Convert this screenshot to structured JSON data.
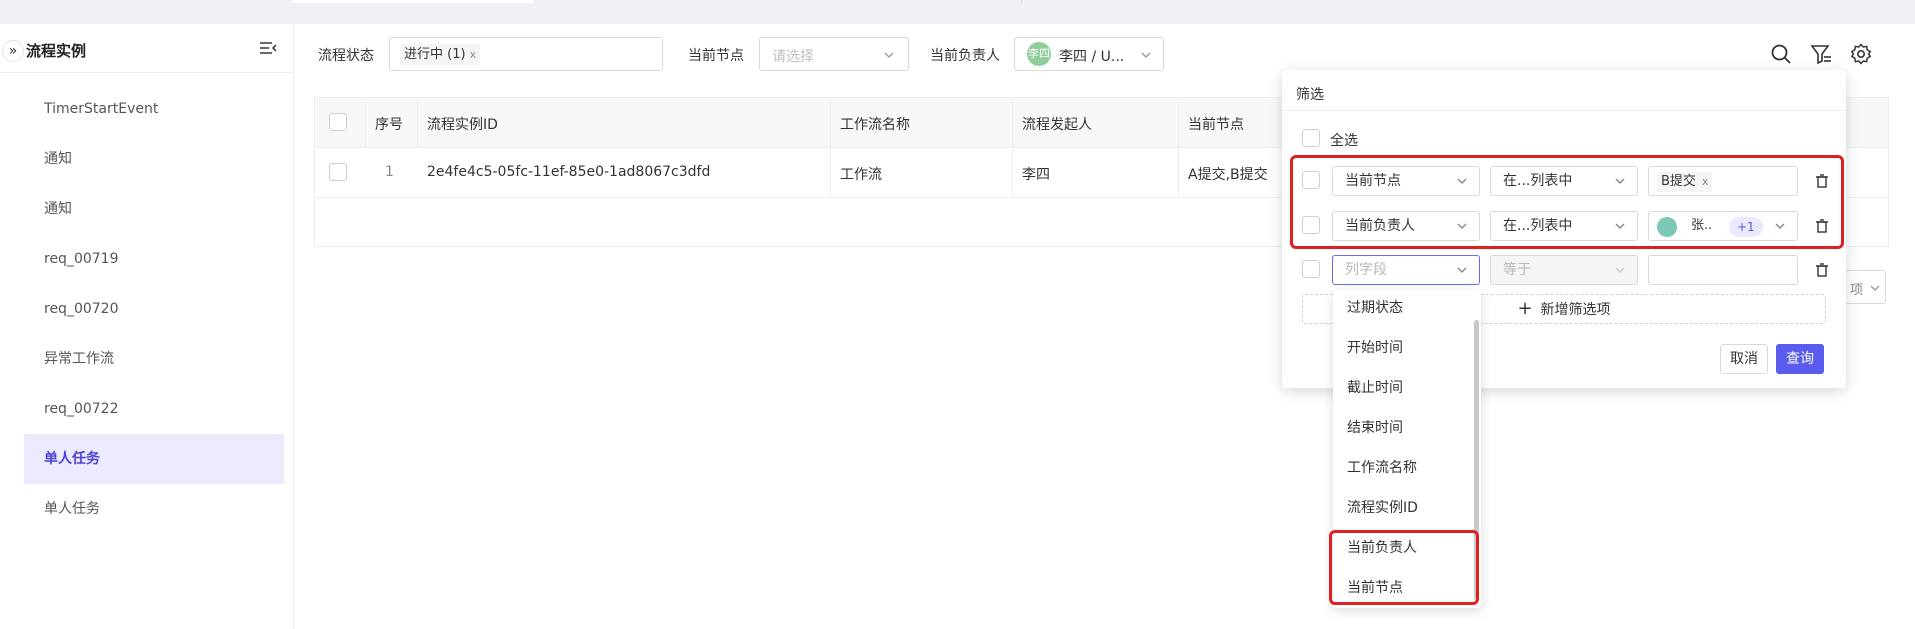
{
  "sidebar": {
    "title": "流程实例",
    "items": [
      {
        "label": "TimerStartEvent"
      },
      {
        "label": "通知"
      },
      {
        "label": "通知"
      },
      {
        "label": "req_00719"
      },
      {
        "label": "req_00720"
      },
      {
        "label": "异常工作流"
      },
      {
        "label": "req_00722"
      },
      {
        "label": "单人任务",
        "active": true
      },
      {
        "label": "单人任务"
      }
    ]
  },
  "filters": {
    "status_label": "流程状态",
    "status_tag": "进行中 (1)",
    "tag_close": "x",
    "node_label": "当前节点",
    "node_placeholder": "请选择",
    "owner_label": "当前负责人",
    "owner_avatar": "李四",
    "owner_value": "李四 / U..."
  },
  "table": {
    "columns": [
      "序号",
      "流程实例ID",
      "工作流名称",
      "流程发起人",
      "当前节点"
    ],
    "rows": [
      {
        "index": "1",
        "id": "2e4fe4c5-05fc-11ef-85e0-1ad8067c3dfd",
        "workflow": "工作流",
        "initiator": "李四",
        "node": "A提交,B提交"
      }
    ]
  },
  "panel": {
    "title": "筛选",
    "select_all": "全选",
    "rows": [
      {
        "field": "当前节点",
        "op": "在...列表中",
        "value_tag": "B提交"
      },
      {
        "field": "当前负责人",
        "op": "在...列表中",
        "value_tag": "张..",
        "more": "+1"
      },
      {
        "field": "列字段",
        "op": "等于",
        "value_tag": ""
      }
    ],
    "add_label": "新增筛选项",
    "cancel": "取消",
    "query": "查询"
  },
  "dropdown": {
    "options": [
      "过期状态",
      "开始时间",
      "截止时间",
      "结束时间",
      "工作流名称",
      "流程实例ID",
      "当前负责人",
      "当前节点"
    ]
  },
  "behind_panel_select": "项"
}
